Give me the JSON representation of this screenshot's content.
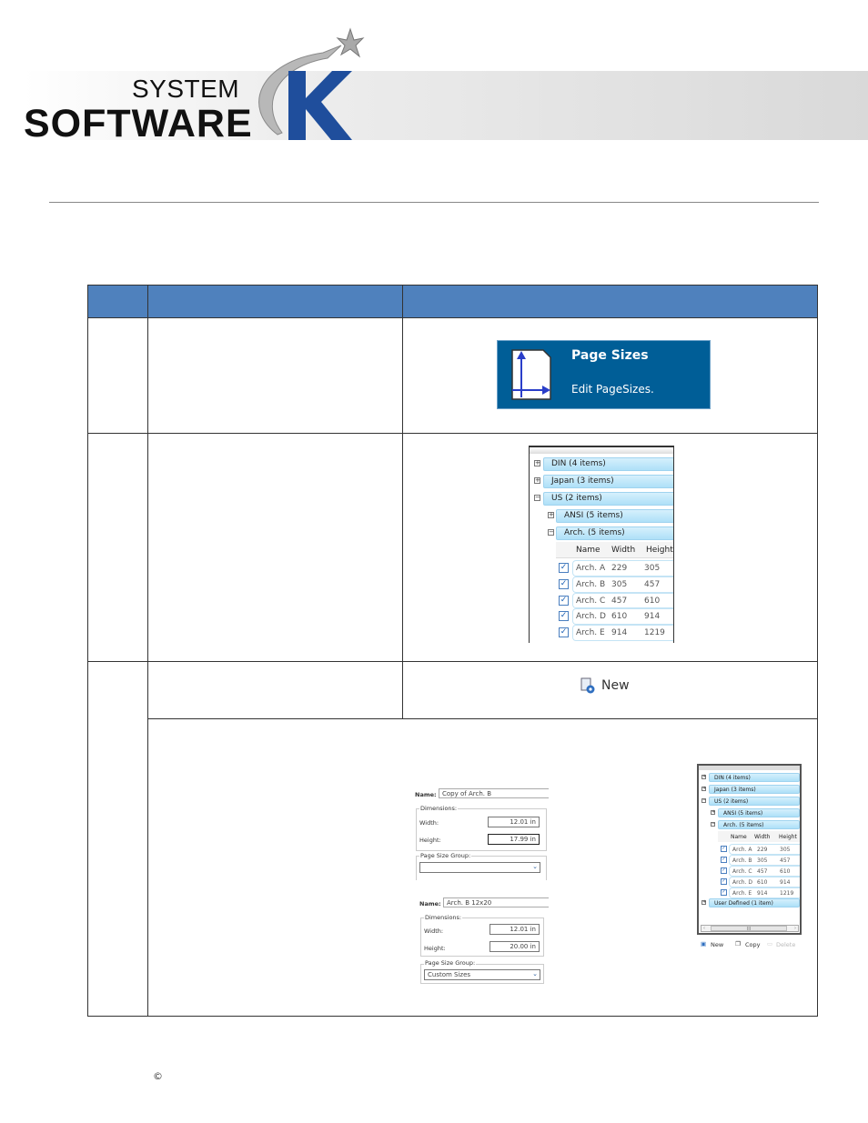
{
  "logo": {
    "line1": "SYSTEM",
    "line2": "SOFTWARE",
    "letter": "K",
    "brand_color": "#1f4e9c"
  },
  "table": {
    "header_color": "#4f81bd"
  },
  "page_sizes_tile": {
    "title": "Page Sizes",
    "subtitle": "Edit PageSizes.",
    "icon": "page-size-axes-icon",
    "bg_color": "#005e97"
  },
  "tree": {
    "groups": [
      "DIN (4 items)",
      "Japan (3 items)",
      "US (2 items)",
      "ANSI (5 items)",
      "Arch. (5 items)"
    ],
    "columns": [
      "Name",
      "Width",
      "Height"
    ],
    "rows": [
      [
        "Arch. A",
        "229",
        "305"
      ],
      [
        "Arch. B",
        "305",
        "457"
      ],
      [
        "Arch. C",
        "457",
        "610"
      ],
      [
        "Arch. D",
        "610",
        "914"
      ],
      [
        "Arch. E",
        "914",
        "1219"
      ]
    ],
    "user_defined": "User Defined (1 item)"
  },
  "new_button": {
    "label": "New",
    "icon": "new-page-icon"
  },
  "bottom_toolbar": {
    "new": "New",
    "copy": "Copy",
    "delete": "Delete",
    "scroll_thumb": "III"
  },
  "form1": {
    "name_label": "Name:",
    "name_value": "Copy of Arch. B",
    "dimensions": "Dimensions:",
    "width_label": "Width:",
    "width_value": "12.01 in",
    "height_label": "Height:",
    "height_value": "17.99 in",
    "group_label": "Page Size Group:",
    "group_value": ""
  },
  "form2": {
    "name_label": "Name:",
    "name_value": "Arch. B 12x20",
    "dimensions": "Dimensions:",
    "width_label": "Width:",
    "width_value": "12.01 in",
    "height_label": "Height:",
    "height_value": "20.00 in",
    "group_label": "Page Size Group:",
    "group_value": "Custom Sizes"
  },
  "footer": {
    "copyright": "©"
  }
}
